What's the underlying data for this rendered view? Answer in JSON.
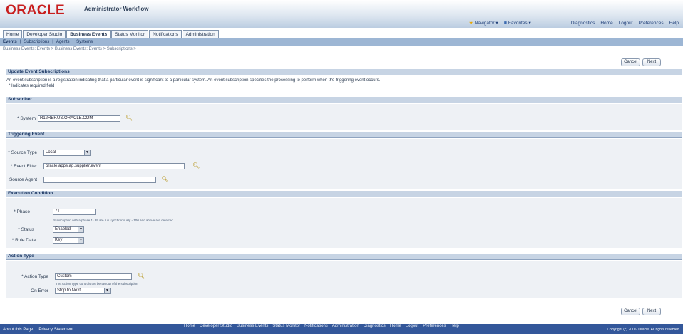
{
  "header": {
    "logo": "ORACLE",
    "app_title": "Administrator Workflow",
    "navigator": "Navigator",
    "favorites": "Favorites",
    "links": [
      "Diagnostics",
      "Home",
      "Logout",
      "Preferences",
      "Help"
    ]
  },
  "tabs": [
    {
      "label": "Home",
      "active": false
    },
    {
      "label": "Developer Studio",
      "active": false
    },
    {
      "label": "Business Events",
      "active": true
    },
    {
      "label": "Status Monitor",
      "active": false
    },
    {
      "label": "Notifications",
      "active": false
    },
    {
      "label": "Administration",
      "active": false
    }
  ],
  "subnav": [
    "Events",
    "Subscriptions",
    "Agents",
    "Systems"
  ],
  "breadcrumb": "Business Events: Events >  Business Events: Events >  Subscriptions >",
  "buttons": {
    "cancel": "Cancel",
    "next": "Next"
  },
  "page": {
    "title": "Update Event Subscriptions",
    "description": "An event subscription is a registration indicating that a particular event is significant to a particular system. An event subscription specifies the processing to perform when the triggering event occurs.",
    "required_note": "* Indicates required field"
  },
  "subscriber": {
    "header": "Subscriber",
    "system_label": "* System",
    "system_value": "R12REF.US.ORACLE.COM"
  },
  "triggering": {
    "header": "Triggering Event",
    "source_type_label": "* Source Type",
    "source_type_value": "Local",
    "event_filter_label": "* Event Filter",
    "event_filter_value": "oracle.apps.ap.supplier.event",
    "source_agent_label": "Source Agent",
    "source_agent_value": ""
  },
  "execution": {
    "header": "Execution Condition",
    "phase_label": "* Phase",
    "phase_value": "71",
    "phase_hint": "Subscription with a phase 1- 99 are run synchronously - 100 and above are deferred",
    "status_label": "* Status",
    "status_value": "Enabled",
    "rule_data_label": "* Rule Data",
    "rule_data_value": "Key"
  },
  "action": {
    "header": "Action Type",
    "action_type_label": "* Action Type",
    "action_type_value": "Custom",
    "action_type_hint": "The Action Type controls the behaviour of the subscription",
    "on_error_label": "On Error",
    "on_error_value": "Stop to Next"
  },
  "footer": {
    "links": [
      "Home",
      "Developer Studio",
      "Business Events",
      "Status Monitor",
      "Notifications",
      "Administration",
      "Diagnostics",
      "Home",
      "Logout",
      "Preferences",
      "Help"
    ],
    "about": "About this Page",
    "privacy": "Privacy Statement",
    "copyright": "Copyright (c) 2006, Oracle. All rights reserved."
  }
}
